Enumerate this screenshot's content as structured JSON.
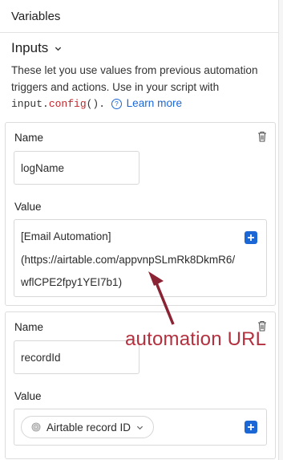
{
  "header": {
    "title": "Variables"
  },
  "section": {
    "title": "Inputs"
  },
  "description": {
    "text": "These let you use values from previous automation triggers and actions. Use in your script with ",
    "code_prefix": "input.",
    "code_key": "config",
    "code_suffix": "().",
    "help_glyph": "?",
    "learn_more": "Learn more"
  },
  "inputs": [
    {
      "name_label": "Name",
      "name_value": "logName",
      "value_label": "Value",
      "value_lines": [
        "[Email Automation]",
        "(https://airtable.com/appvnpSLmRk8DkmR6/",
        "wflCPE2fpy1YEI7b1)"
      ]
    },
    {
      "name_label": "Name",
      "name_value": "recordId",
      "value_label": "Value",
      "pill_label": "Airtable record ID"
    }
  ],
  "annotation": {
    "text": "automation URL",
    "color": "#b3303f"
  },
  "colors": {
    "accent": "#1b67d6",
    "code": "#c1272d"
  },
  "icons": [
    "chevron-down-icon",
    "help-circle-icon",
    "trash-icon",
    "plus-icon",
    "fingerprint-icon"
  ]
}
